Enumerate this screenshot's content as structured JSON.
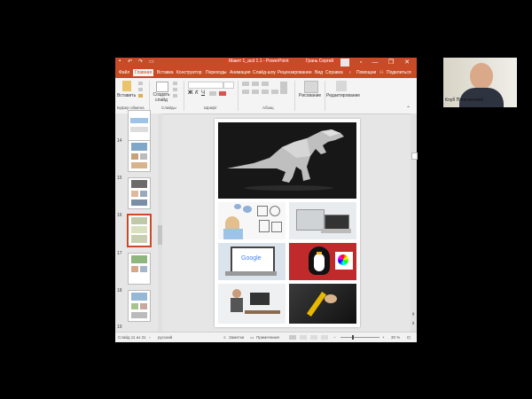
{
  "window": {
    "title": "Макет 1_acd 1.1 - PowerPoint",
    "user": "Грань Сергей",
    "minimize": "—",
    "restore": "❐",
    "close": "✕"
  },
  "tabs": [
    {
      "label": "Файл"
    },
    {
      "label": "Главная"
    },
    {
      "label": "Вставка"
    },
    {
      "label": "Конструктор"
    },
    {
      "label": "Переходы"
    },
    {
      "label": "Анимация"
    },
    {
      "label": "Слайд-шоу"
    },
    {
      "label": "Рецензирование"
    },
    {
      "label": "Вид"
    },
    {
      "label": "Справка"
    },
    {
      "label": "Помощни"
    },
    {
      "label": "Поделиться"
    }
  ],
  "ribbon": {
    "paste": "Вставить",
    "new_slide": "Создать слайд",
    "drawing": "Рисование",
    "editing": "Редактирование",
    "groups": {
      "clipboard": "Буфер обмена",
      "slides": "Слайды",
      "font": "Шрифт",
      "paragraph": "Абзац"
    }
  },
  "thumbnails": [
    {
      "num": "14"
    },
    {
      "num": "15"
    },
    {
      "num": "16"
    },
    {
      "num": "17"
    },
    {
      "num": "18"
    },
    {
      "num": "19"
    }
  ],
  "status": {
    "slide": "Слайд 11 из 31",
    "language": "русский",
    "notes": "Заметки",
    "comments": "Примечания",
    "zoom": "30 %"
  },
  "slide_images": {
    "google_text": "Google"
  },
  "webcam": {
    "name": "Клуб Попечителей"
  },
  "colors": {
    "accent": "#c94a26",
    "ribbon": "#f4f4f4",
    "background": "#000000"
  }
}
